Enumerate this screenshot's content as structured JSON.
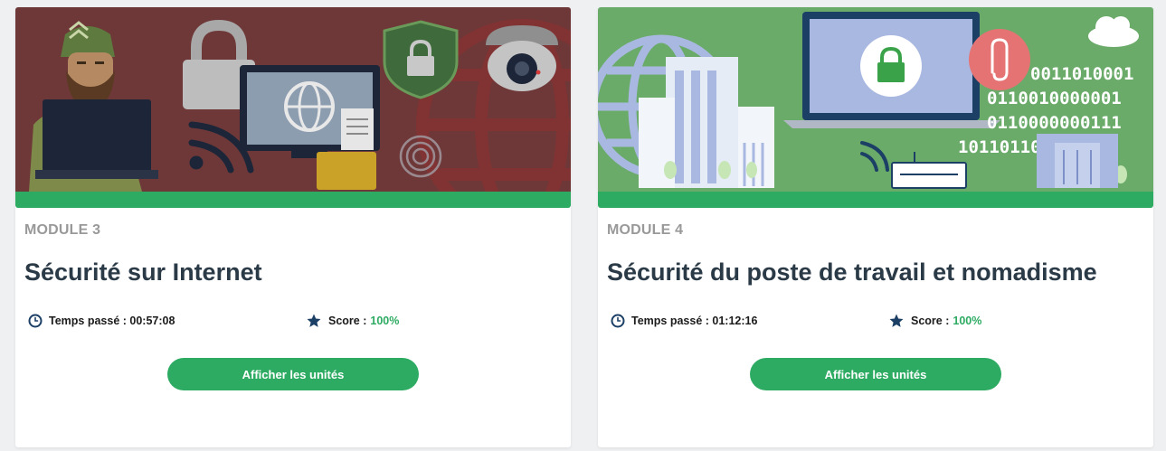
{
  "modules": [
    {
      "label": "MODULE 3",
      "title": "Sécurité sur Internet",
      "time_label": "Temps passé :",
      "time_value": "00:57:08",
      "score_label": "Score :",
      "score_value": "100%",
      "button_label": "Afficher les unités",
      "progress": 1.0,
      "banner_color": "#6e3838"
    },
    {
      "label": "MODULE 4",
      "title": "Sécurité du poste de travail et nomadisme",
      "time_label": "Temps passé :",
      "time_value": "01:12:16",
      "score_label": "Score :",
      "score_value": "100%",
      "button_label": "Afficher les unités",
      "progress": 1.0,
      "banner_color": "#6aab6a",
      "binary_lines": [
        "0011010001",
        "0110010000001",
        "0110000000111",
        "101101101"
      ]
    }
  ],
  "colors": {
    "accent": "#2dab62",
    "title": "#2b3a47",
    "muted": "#999999",
    "icon_dark": "#1c3f66"
  }
}
